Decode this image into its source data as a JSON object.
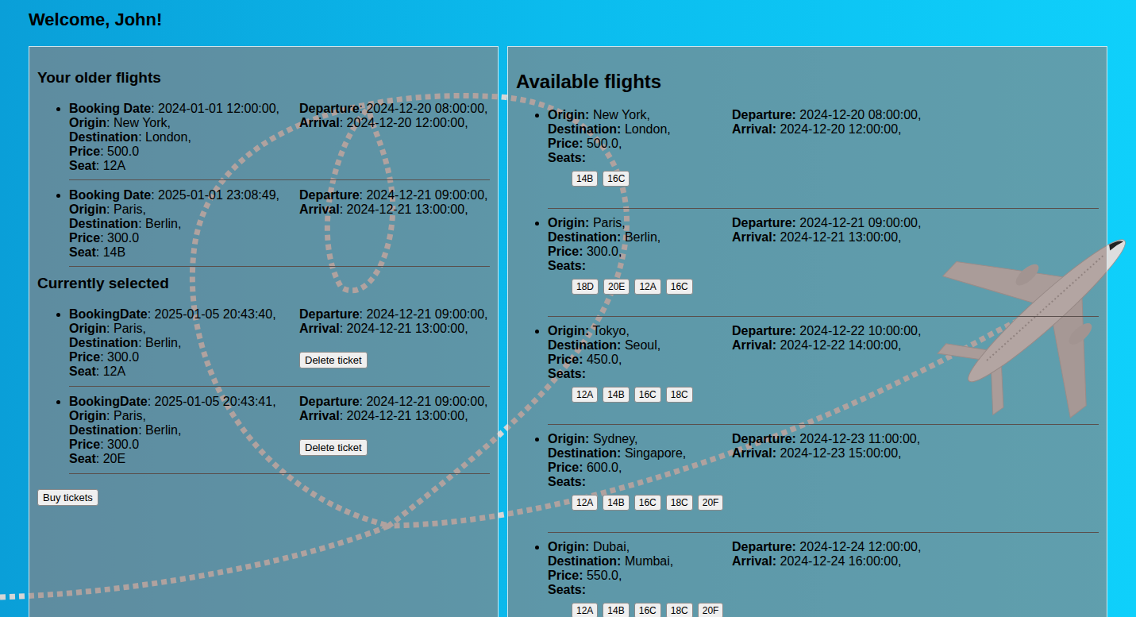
{
  "header": {
    "title": "Welcome, John!"
  },
  "older_flights": {
    "title": "Your older flights",
    "items": [
      {
        "left": [
          {
            "label": "Booking Date",
            "value": ": 2024-01-01 12:00:00,"
          },
          {
            "label": "Origin",
            "value": ": New York,"
          },
          {
            "label": "Destination",
            "value": ": London,"
          },
          {
            "label": "Price",
            "value": ": 500.0"
          },
          {
            "label": "Seat",
            "value": ": 12A"
          }
        ],
        "right": [
          {
            "label": "Departure",
            "value": ": 2024-12-20 08:00:00,"
          },
          {
            "label": "Arrival",
            "value": ": 2024-12-20 12:00:00,"
          }
        ]
      },
      {
        "left": [
          {
            "label": "Booking Date",
            "value": ": 2025-01-01 23:08:49,"
          },
          {
            "label": "Origin",
            "value": ": Paris,"
          },
          {
            "label": "Destination",
            "value": ": Berlin,"
          },
          {
            "label": "Price",
            "value": ": 300.0"
          },
          {
            "label": "Seat",
            "value": ": 14B"
          }
        ],
        "right": [
          {
            "label": "Departure",
            "value": ": 2024-12-21 09:00:00,"
          },
          {
            "label": "Arrival",
            "value": ": 2024-12-21 13:00:00,"
          }
        ]
      }
    ]
  },
  "current_selection": {
    "title": "Currently selected",
    "items": [
      {
        "left": [
          {
            "label": "BookingDate",
            "value": ": 2025-01-05 20:43:40,"
          },
          {
            "label": "Origin",
            "value": ": Paris,"
          },
          {
            "label": "Destination",
            "value": ": Berlin,"
          },
          {
            "label": "Price",
            "value": ": 300.0"
          },
          {
            "label": "Seat",
            "value": ": 12A"
          }
        ],
        "right": [
          {
            "label": "Departure",
            "value": ": 2024-12-21 09:00:00,"
          },
          {
            "label": "Arrival",
            "value": ": 2024-12-21 13:00:00,"
          }
        ],
        "action": "Delete ticket"
      },
      {
        "left": [
          {
            "label": "BookingDate",
            "value": ": 2025-01-05 20:43:41,"
          },
          {
            "label": "Origin",
            "value": ": Paris,"
          },
          {
            "label": "Destination",
            "value": ": Berlin,"
          },
          {
            "label": "Price",
            "value": ": 300.0"
          },
          {
            "label": "Seat",
            "value": ": 20E"
          }
        ],
        "right": [
          {
            "label": "Departure",
            "value": ": 2024-12-21 09:00:00,"
          },
          {
            "label": "Arrival",
            "value": ": 2024-12-21 13:00:00,"
          }
        ],
        "action": "Delete ticket"
      }
    ],
    "buy_button": "Buy tickets"
  },
  "available_flights": {
    "title": "Available flights",
    "items": [
      {
        "left": [
          {
            "label": "Origin:",
            "value": " New York,"
          },
          {
            "label": "Destination:",
            "value": " London,"
          },
          {
            "label": "Price:",
            "value": " 500.0,"
          }
        ],
        "seats_label": "Seats:",
        "seats": [
          "14B",
          "16C"
        ],
        "right": [
          {
            "label": "Departure:",
            "value": " 2024-12-20 08:00:00,"
          },
          {
            "label": "Arrival:",
            "value": " 2024-12-20 12:00:00,"
          }
        ]
      },
      {
        "left": [
          {
            "label": "Origin:",
            "value": " Paris,"
          },
          {
            "label": "Destination:",
            "value": " Berlin,"
          },
          {
            "label": "Price:",
            "value": " 300.0,"
          }
        ],
        "seats_label": "Seats:",
        "seats": [
          "18D",
          "20E",
          "12A",
          "16C"
        ],
        "right": [
          {
            "label": "Departure:",
            "value": " 2024-12-21 09:00:00,"
          },
          {
            "label": "Arrival:",
            "value": " 2024-12-21 13:00:00,"
          }
        ]
      },
      {
        "left": [
          {
            "label": "Origin:",
            "value": " Tokyo,"
          },
          {
            "label": "Destination:",
            "value": " Seoul,"
          },
          {
            "label": "Price:",
            "value": " 450.0,"
          }
        ],
        "seats_label": "Seats:",
        "seats": [
          "12A",
          "14B",
          "16C",
          "18C"
        ],
        "right": [
          {
            "label": "Departure:",
            "value": " 2024-12-22 10:00:00,"
          },
          {
            "label": "Arrival:",
            "value": " 2024-12-22 14:00:00,"
          }
        ]
      },
      {
        "left": [
          {
            "label": "Origin:",
            "value": " Sydney,"
          },
          {
            "label": "Destination:",
            "value": " Singapore,"
          },
          {
            "label": "Price:",
            "value": " 600.0,"
          }
        ],
        "seats_label": "Seats:",
        "seats": [
          "12A",
          "14B",
          "16C",
          "18C",
          "20F"
        ],
        "right": [
          {
            "label": "Departure:",
            "value": " 2024-12-23 11:00:00,"
          },
          {
            "label": "Arrival:",
            "value": " 2024-12-23 15:00:00,"
          }
        ]
      },
      {
        "left": [
          {
            "label": "Origin:",
            "value": " Dubai,"
          },
          {
            "label": "Destination:",
            "value": " Mumbai,"
          },
          {
            "label": "Price:",
            "value": " 550.0,"
          }
        ],
        "seats_label": "Seats:",
        "seats": [
          "12A",
          "14B",
          "16C",
          "18C",
          "20F"
        ],
        "right": [
          {
            "label": "Departure:",
            "value": " 2024-12-24 12:00:00,"
          },
          {
            "label": "Arrival:",
            "value": " 2024-12-24 16:00:00,"
          }
        ]
      }
    ]
  }
}
